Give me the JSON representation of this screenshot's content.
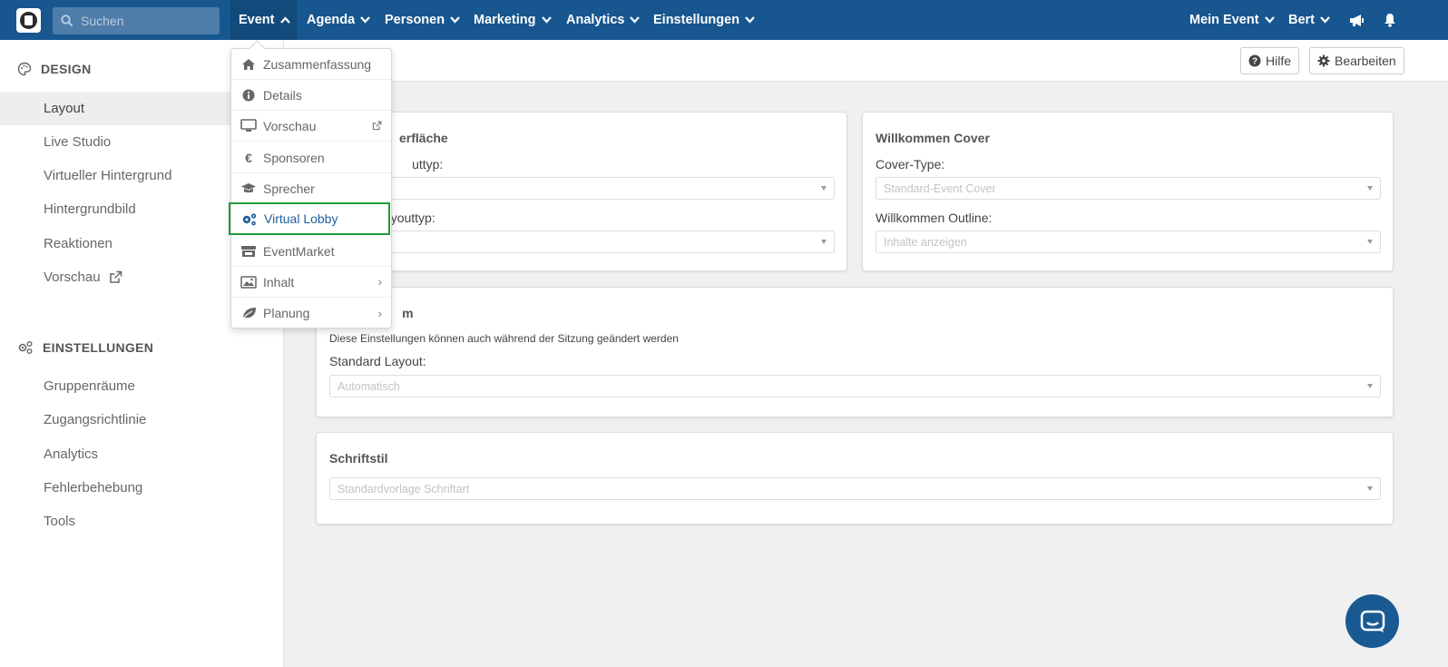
{
  "topnav": {
    "search_placeholder": "Suchen",
    "items": [
      {
        "label": "Event"
      },
      {
        "label": "Agenda"
      },
      {
        "label": "Personen"
      },
      {
        "label": "Marketing"
      },
      {
        "label": "Analytics"
      },
      {
        "label": "Einstellungen"
      }
    ],
    "right": {
      "event": "Mein Event",
      "user": "Bert"
    },
    "colors": {
      "bar": "#17568f",
      "active": "#124a7c"
    }
  },
  "sidebar": {
    "design_title": "DESIGN",
    "design_items": [
      {
        "label": "Layout"
      },
      {
        "label": "Live Studio"
      },
      {
        "label": "Virtueller Hintergrund"
      },
      {
        "label": "Hintergrundbild"
      },
      {
        "label": "Reaktionen"
      },
      {
        "label": "Vorschau"
      }
    ],
    "settings_title": "EINSTELLUNGEN",
    "settings_items": [
      {
        "label": "Gruppenräume"
      },
      {
        "label": "Zugangsrichtlinie"
      },
      {
        "label": "Analytics"
      },
      {
        "label": "Fehlerbehebung"
      },
      {
        "label": "Tools"
      }
    ]
  },
  "header": {
    "help": "Hilfe",
    "edit": "Bearbeiten"
  },
  "panels": {
    "ui": {
      "title_partial": "erfläche",
      "label1_partial": "uttyp:",
      "label2_partial": "youttyp:"
    },
    "cover": {
      "title": "Willkommen Cover",
      "label1": "Cover-Type:",
      "select1": "Standard-Event Cover",
      "label2": "Willkommen Outline:",
      "select2": "Inhalte anzeigen"
    },
    "room": {
      "title_partial": "m",
      "note": "Diese Einstellungen können auch während der Sitzung geändert werden",
      "label": "Standard Layout:",
      "select": "Automatisch"
    },
    "font": {
      "title": "Schriftstil",
      "select": "Standardvorlage Schriftart"
    }
  },
  "dropdown": {
    "items": [
      {
        "label": "Zusammenfassung",
        "icon": "home-icon"
      },
      {
        "label": "Details",
        "icon": "info-icon"
      },
      {
        "label": "Vorschau",
        "icon": "monitor-icon"
      },
      {
        "label": "Sponsoren",
        "icon": "euro-icon"
      },
      {
        "label": "Sprecher",
        "icon": "graduation-cap-icon"
      },
      {
        "label": "Virtual Lobby",
        "icon": "gears-icon"
      },
      {
        "label": "EventMarket",
        "icon": "store-icon"
      },
      {
        "label": "Inhalt",
        "icon": "images-icon"
      },
      {
        "label": "Planung",
        "icon": "leaf-icon"
      }
    ],
    "highlight_color": "#1f9d3c"
  }
}
